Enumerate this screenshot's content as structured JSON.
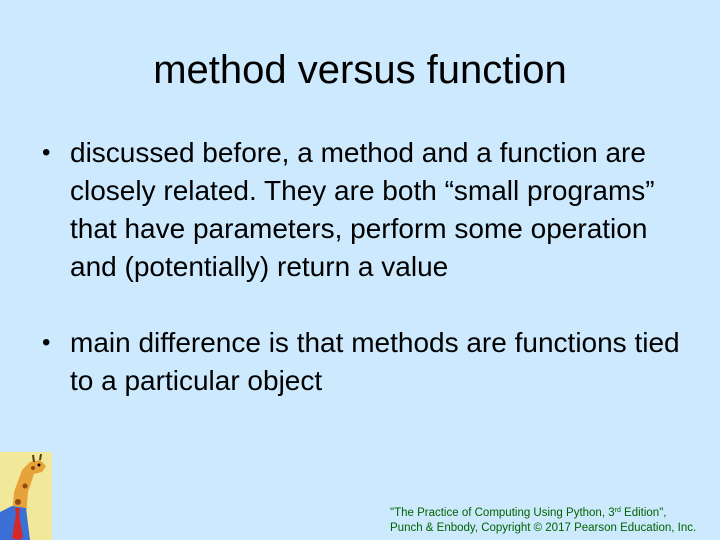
{
  "slide": {
    "title": "method versus function",
    "bullets": [
      "discussed before, a method and a function are closely related. They are both “small programs” that have parameters, perform some operation and (potentially) return a value",
      "main difference is that methods are functions tied to a particular object"
    ]
  },
  "footer": {
    "line1_prefix": "\"The Practice of Computing Using Python, 3",
    "line1_sup": "rd",
    "line1_suffix": " Edition\",",
    "line2": "Punch & Enbody, Copyright © 2017 Pearson Education, Inc."
  },
  "colors": {
    "background": "#cce9fd",
    "footer_text": "#006400"
  },
  "icons": {
    "logo": "giraffe-logo-icon"
  }
}
